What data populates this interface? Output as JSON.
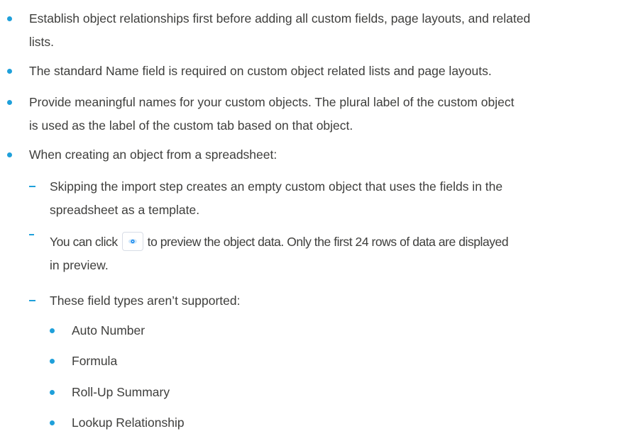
{
  "list": {
    "items": [
      {
        "line1": "Establish object relationships first before adding all custom fields, page layouts, and related",
        "line2": "lists."
      },
      {
        "line1": "The standard Name field is required on custom object related lists and page layouts."
      },
      {
        "line1": "Provide meaningful names for your custom objects. The plural label of the custom object",
        "line2": "is used as the label of the custom tab based on that object."
      },
      {
        "line1": "When creating an object from a spreadsheet:"
      }
    ],
    "subitems": [
      {
        "line1": "Skipping the import step creates an empty custom object that uses the fields in the",
        "line2": "spreadsheet as a template."
      },
      {
        "line1_before_icon": "You can click",
        "line1_after_icon": "to preview the object data. Only the first 24 rows of data are displayed",
        "line2": "in preview.",
        "icon": "eye-icon"
      },
      {
        "line1": "These field types aren’t supported:"
      }
    ],
    "unsupported_types": [
      "Auto Number",
      "Formula",
      "Roll-Up Summary",
      "Lookup Relationship"
    ]
  },
  "colors": {
    "bullet": "#1fa0da",
    "text": "#3e3e3c",
    "icon": "#1589ee"
  }
}
